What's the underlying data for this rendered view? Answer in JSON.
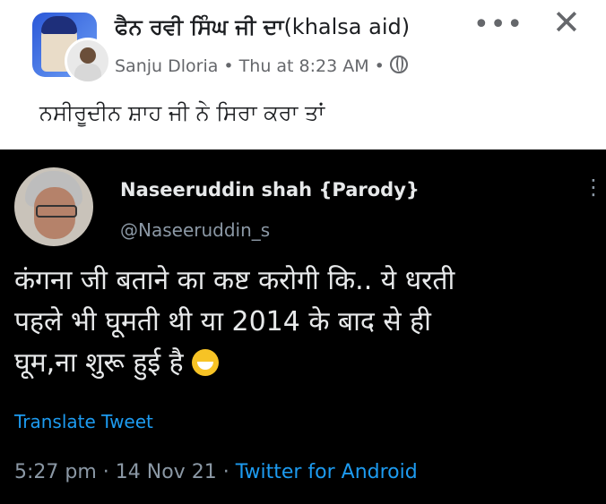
{
  "facebook_post": {
    "group_name_punjabi": "ਫੈਨ ਰਵੀ ਸਿੰਘ ਜੀ ਦਾ",
    "group_name_latin": "(khalsa aid)",
    "author": "Sanju Dloria",
    "separator": " • ",
    "time": "Thu at 8:23 AM",
    "separator2": " • ",
    "more_icon": "more-horizontal-icon",
    "more_glyph": "•••",
    "close_icon": "close-icon",
    "close_glyph": "✕",
    "privacy_icon": "globe-icon",
    "caption": "ਨਸੀਰੂਦੀਨ ਸ਼ਾਹ ਜੀ ਨੇ ਸਿਰਾ ਕਰਾ ਤਾਂ"
  },
  "tweet": {
    "name": "Naseeruddin shah {Parody}",
    "handle": "@Naseeruddin_s",
    "kebab_glyph": "⋮",
    "lines": [
      "कंगना जी बताने का कष्ट करोगी कि.. ये धरती",
      "पहले भी घूमती थी या 2014 के बाद से ही",
      "घूम,ना शुरू हुई है"
    ],
    "emoji_icon": "face-with-tears-of-joy-icon",
    "translate": "Translate Tweet",
    "time": "5:27 pm",
    "dot1": " · ",
    "date": "14 Nov 21",
    "dot2": " · ",
    "source": "Twitter for Android"
  },
  "colors": {
    "link_blue": "#1d9bf0",
    "twitter_bg": "#000000",
    "facebook_bg": "#ffffff",
    "muted_gray": "#65676b"
  }
}
